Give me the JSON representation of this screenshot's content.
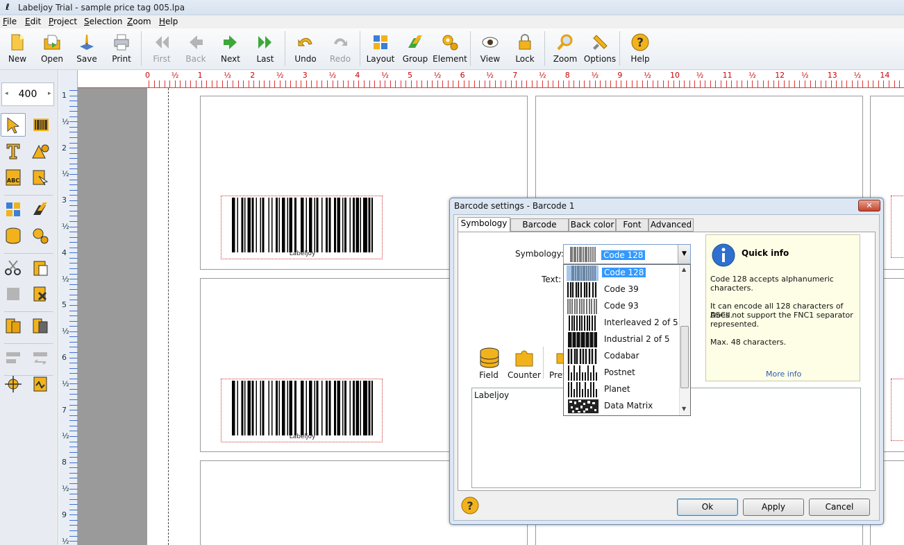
{
  "window": {
    "title": "Labeljoy Trial - sample price tag 005.lpa"
  },
  "menu": [
    {
      "key": "F",
      "rest": "ile"
    },
    {
      "key": "E",
      "rest": "dit"
    },
    {
      "key": "P",
      "rest": "roject"
    },
    {
      "key": "S",
      "rest": "election"
    },
    {
      "key": "Z",
      "rest": "oom"
    },
    {
      "key": "H",
      "rest": "elp"
    }
  ],
  "toolbar": {
    "new": "New",
    "open": "Open",
    "save": "Save",
    "print": "Print",
    "first": "First",
    "back": "Back",
    "next": "Next",
    "last": "Last",
    "undo": "Undo",
    "redo": "Redo",
    "layout": "Layout",
    "group": "Group",
    "element": "Element",
    "view": "View",
    "lock": "Lock",
    "zoom": "Zoom",
    "options": "Options",
    "help": "Help"
  },
  "zoom_value": "400",
  "ruler": {
    "h_labels": [
      "0",
      "½",
      "1",
      "½",
      "2",
      "½",
      "3",
      "½",
      "4",
      "½",
      "5",
      "½",
      "6",
      "½",
      "7",
      "½",
      "8",
      "½",
      "9",
      "½",
      "10",
      "½",
      "11",
      "½",
      "12",
      "½",
      "13",
      "½",
      "14"
    ],
    "v_labels": [
      "1",
      "½",
      "2",
      "½",
      "3",
      "½",
      "4",
      "½",
      "5",
      "½",
      "6",
      "½",
      "7",
      "½",
      "8",
      "½",
      "9",
      "½"
    ]
  },
  "canvas": {
    "barcode_text": "Labeljoy"
  },
  "dialog": {
    "title": "Barcode settings - Barcode 1",
    "close": "✕",
    "tabs": [
      "Symbology",
      "Barcode color",
      "Back color",
      "Font",
      "Advanced"
    ],
    "symbology_label": "Symbology:",
    "symbology_value": "Code 128",
    "text_label": "Text:",
    "options": [
      "Code 128",
      "Code 39",
      "Code 93",
      "Interleaved 2 of 5",
      "Industrial 2 of 5",
      "Codabar",
      "Postnet",
      "Planet",
      "Data Matrix"
    ],
    "field_label": "Field",
    "counter_label": "Counter",
    "preview_label": "Prev",
    "text_value": "Labeljoy",
    "quick_info": {
      "title": "Quick info",
      "line1": "Code 128 accepts alphanumeric",
      "line2": "characters.",
      "line3": "It can encode all 128 characters of ASCII.",
      "line4": "Does not support the FNC1 separator",
      "line5": "represented.",
      "line6": "Max. 48 characters.",
      "more": "More info"
    },
    "ok": "Ok",
    "apply": "Apply",
    "cancel": "Cancel"
  },
  "colors": {
    "accent": "#3399ff",
    "ruler_red": "#cc0000",
    "ruler_blue": "#3d6fd1",
    "icon_yellow": "#f2b21b",
    "icon_green": "#3da83a"
  }
}
